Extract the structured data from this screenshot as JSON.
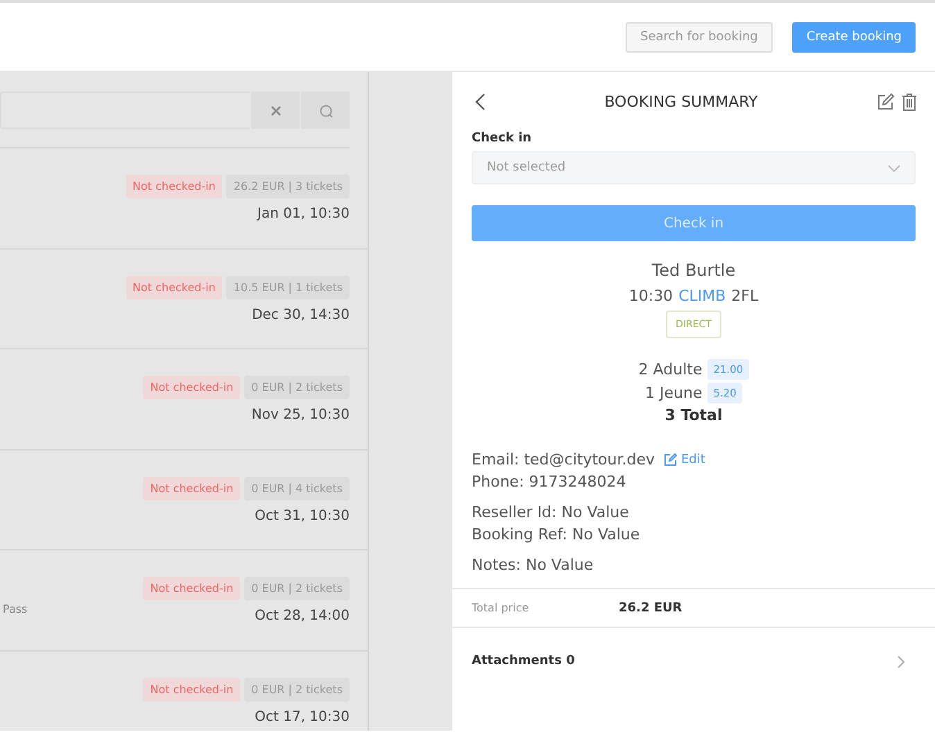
{
  "header": {
    "search_button": "Search for booking",
    "create_button": "Create booking"
  },
  "bookings": [
    {
      "status": "Not checked-in",
      "summary": "26.2 EUR | 3 tickets",
      "date": "Jan 01, 10:30"
    },
    {
      "status": "Not checked-in",
      "summary": "10.5 EUR | 1 tickets",
      "date": "Dec 30, 14:30"
    },
    {
      "status": "Not checked-in",
      "summary": "0 EUR | 2 tickets",
      "date": "Nov 25, 10:30"
    },
    {
      "status": "Not checked-in",
      "summary": "0 EUR | 4 tickets",
      "date": "Oct 31, 10:30"
    },
    {
      "status": "Not checked-in",
      "summary": "0 EUR | 2 tickets",
      "date": "Oct 28, 14:00",
      "detail": "Pass"
    },
    {
      "status": "Not checked-in",
      "summary": "0 EUR | 2 tickets",
      "date": "Oct 17, 10:30"
    }
  ],
  "summary": {
    "title": "BOOKING SUMMARY",
    "check_in": {
      "label": "Check in",
      "placeholder": "Not selected"
    },
    "check_in_button": {
      "label": "Check in",
      "disabled": true
    },
    "customer": "Ted Burtle",
    "time": "10:30",
    "activity": "CLIMB",
    "location": "2FL",
    "channel": "DIRECT",
    "tickets": [
      {
        "label": "2 Adulte",
        "price": "21.00"
      },
      {
        "label": "1 Jeune",
        "price": "5.20"
      }
    ],
    "total": "3 Total",
    "email": "Email: ted@citytour.dev",
    "edit": "Edit",
    "phone": "Phone: 9173248024",
    "reseller": "Reseller Id: No Value",
    "booking_ref": "Booking Ref: No Value",
    "notes": "Notes: No Value",
    "total_price_label": "Total price",
    "total_price": "26.2 EUR",
    "attachments": "Attachments 0"
  }
}
